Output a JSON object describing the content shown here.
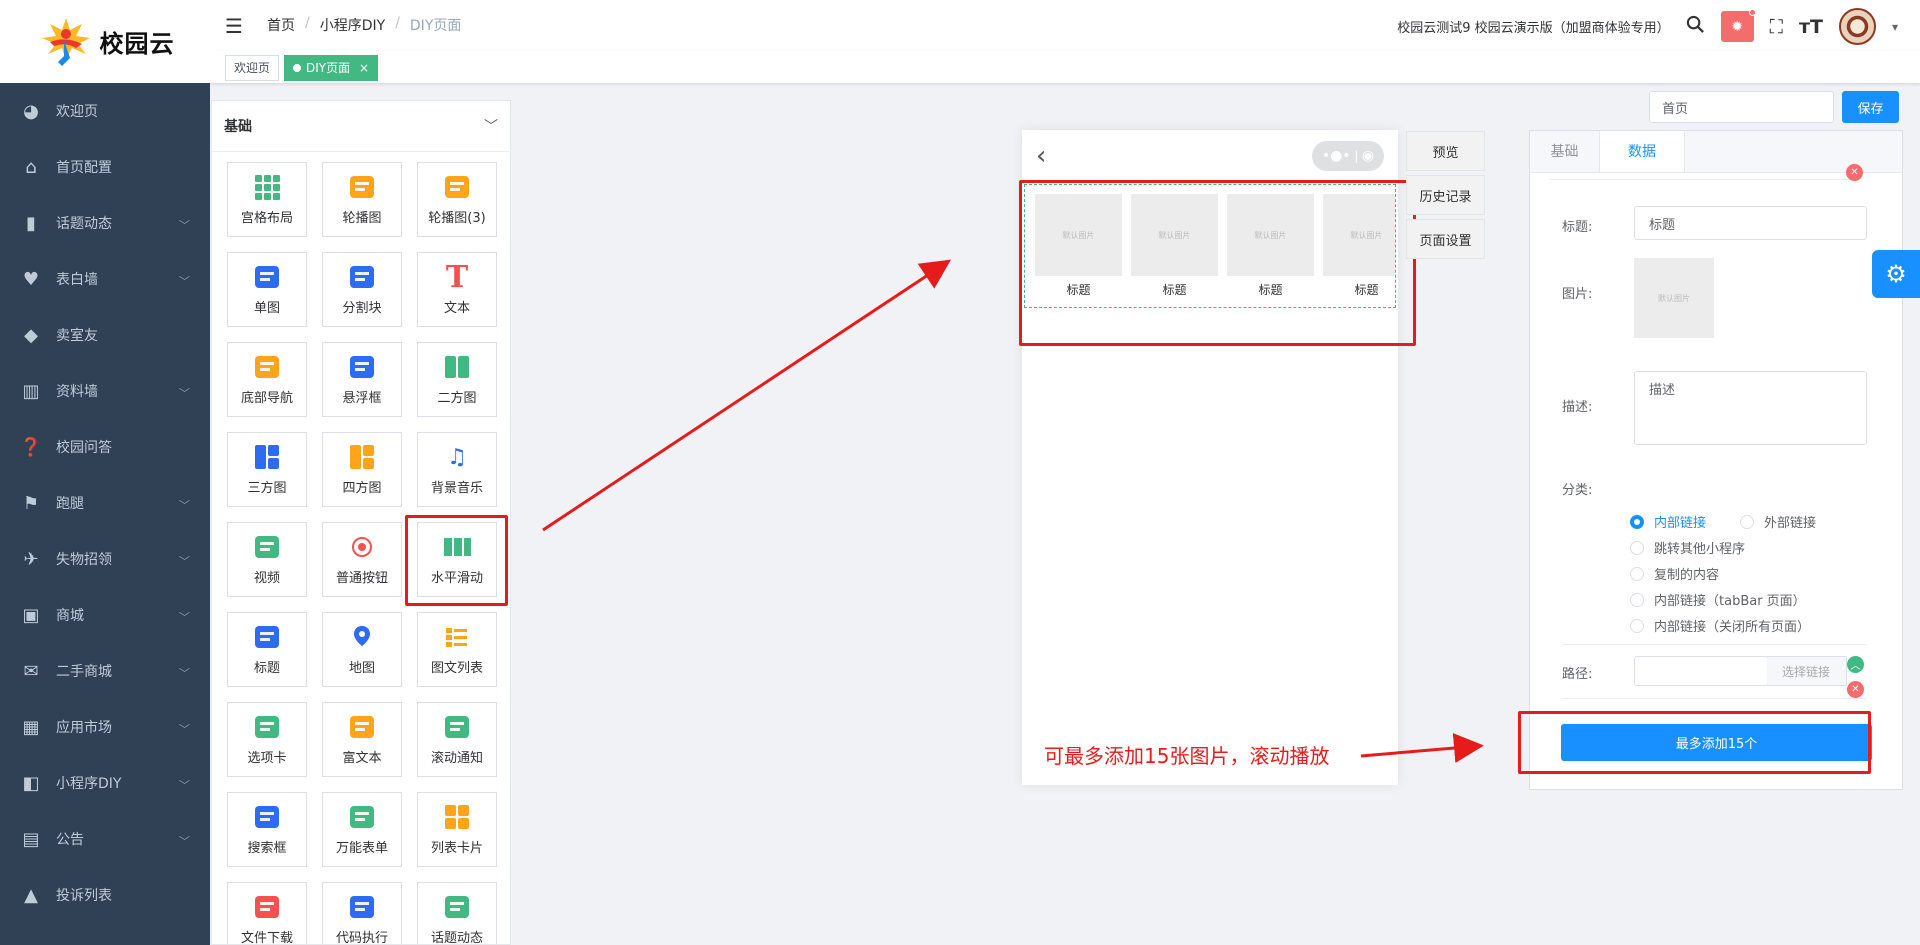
{
  "header": {
    "logo_text": "校园云",
    "breadcrumb": [
      "首页",
      "小程序DIY",
      "DIY页面"
    ],
    "breadcrumb_sep": "/",
    "site_name": "校园云测试9 校园云演示版（加盟商体验专用）",
    "icons": [
      "search-icon",
      "bug-icon",
      "fullscreen-icon",
      "font-size-icon"
    ]
  },
  "tags": [
    {
      "label": "欢迎页",
      "active": false
    },
    {
      "label": "DIY页面",
      "active": true,
      "close": "×"
    }
  ],
  "sidebar": {
    "items": [
      {
        "label": "欢迎页",
        "icon": "dashboard-icon",
        "arrow": ""
      },
      {
        "label": "首页配置",
        "icon": "home-icon",
        "arrow": ""
      },
      {
        "label": "话题动态",
        "icon": "book-icon",
        "arrow": "﹀"
      },
      {
        "label": "表白墙",
        "icon": "heart-icon",
        "arrow": "﹀"
      },
      {
        "label": "卖室友",
        "icon": "tag-icon",
        "arrow": ""
      },
      {
        "label": "资料墙",
        "icon": "library-icon",
        "arrow": "﹀"
      },
      {
        "label": "校园问答",
        "icon": "qa-icon",
        "arrow": ""
      },
      {
        "label": "跑腿",
        "icon": "errand-icon",
        "arrow": "﹀"
      },
      {
        "label": "失物招领",
        "icon": "lost-icon",
        "arrow": "﹀"
      },
      {
        "label": "商城",
        "icon": "shop-icon",
        "arrow": "﹀"
      },
      {
        "label": "二手商城",
        "icon": "gift-icon",
        "arrow": "﹀"
      },
      {
        "label": "应用市场",
        "icon": "apps-icon",
        "arrow": "﹀"
      },
      {
        "label": "小程序DIY",
        "icon": "diy-icon",
        "arrow": "﹀"
      },
      {
        "label": "公告",
        "icon": "notice-icon",
        "arrow": "﹀"
      },
      {
        "label": "投诉列表",
        "icon": "warning-icon",
        "arrow": ""
      }
    ]
  },
  "components": {
    "section_title": "基础",
    "items": [
      {
        "label": "宫格布局",
        "icon": "grid-icon",
        "color": "#42b983"
      },
      {
        "label": "轮播图",
        "icon": "carousel-icon",
        "color": "#ffa41b"
      },
      {
        "label": "轮播图(3)",
        "icon": "carousel3-icon",
        "color": "#ffa41b"
      },
      {
        "label": "单图",
        "icon": "image-icon",
        "color": "#2d6cf0"
      },
      {
        "label": "分割块",
        "icon": "divider-icon",
        "color": "#2d6cf0"
      },
      {
        "label": "文本",
        "icon": "text-icon",
        "color": "#f55151"
      },
      {
        "label": "底部导航",
        "icon": "bottom-nav-icon",
        "color": "#ffa41b"
      },
      {
        "label": "悬浮框",
        "icon": "float-icon",
        "color": "#2d6cf0"
      },
      {
        "label": "二方图",
        "icon": "two-pane-icon",
        "color": "#42b983"
      },
      {
        "label": "三方图",
        "icon": "three-pane-icon",
        "color": "#2d6cf0"
      },
      {
        "label": "四方图",
        "icon": "four-pane-icon",
        "color": "#ffa41b"
      },
      {
        "label": "背景音乐",
        "icon": "music-icon",
        "color": "#2d6cf0"
      },
      {
        "label": "视频",
        "icon": "video-icon",
        "color": "#42b983"
      },
      {
        "label": "普通按钮",
        "icon": "button-icon",
        "color": "#f55151"
      },
      {
        "label": "水平滑动",
        "icon": "slider-icon",
        "color": "#42b983"
      },
      {
        "label": "标题",
        "icon": "title-icon",
        "color": "#2d6cf0"
      },
      {
        "label": "地图",
        "icon": "map-icon",
        "color": "#2d6cf0"
      },
      {
        "label": "图文列表",
        "icon": "list-icon",
        "color": "#ffa41b"
      },
      {
        "label": "选项卡",
        "icon": "tab-icon",
        "color": "#42b983"
      },
      {
        "label": "富文本",
        "icon": "richtext-icon",
        "color": "#ffa41b"
      },
      {
        "label": "滚动通知",
        "icon": "notice-scroll-icon",
        "color": "#42b983"
      },
      {
        "label": "搜索框",
        "icon": "search-box-icon",
        "color": "#2d6cf0"
      },
      {
        "label": "万能表单",
        "icon": "form-icon",
        "color": "#42b983"
      },
      {
        "label": "列表卡片",
        "icon": "card-icon",
        "color": "#ffa41b"
      },
      {
        "label": "文件下载",
        "icon": "download-icon",
        "color": "#f55151"
      },
      {
        "label": "代码执行",
        "icon": "code-icon",
        "color": "#2d6cf0"
      },
      {
        "label": "话题动态",
        "icon": "topic-icon",
        "color": "#42b983"
      }
    ]
  },
  "preview": {
    "back": "‹",
    "placeholder_text": "默认图片",
    "slides": [
      "标题",
      "标题",
      "标题",
      "标题"
    ],
    "buttons": [
      "预览",
      "历史记录",
      "页面设置"
    ]
  },
  "settings": {
    "page_name": "首页",
    "save_label": "保存",
    "tabs": [
      "基础",
      "数据"
    ],
    "title_label": "标题:",
    "title_value": "标题",
    "image_label": "图片:",
    "image_placeholder": "默认图片",
    "desc_label": "描述:",
    "desc_value": "描述",
    "category_label": "分类:",
    "radios": [
      "内部链接",
      "外部链接",
      "跳转其他小程序",
      "复制的内容",
      "内部链接（tabBar 页面）",
      "内部链接（关闭所有页面）"
    ],
    "path_label": "路径:",
    "path_value": "",
    "select_link": "选择链接",
    "add_button": "最多添加15个"
  },
  "annotation": {
    "text": "可最多添加15张图片，滚动播放",
    "color": "#e61c1c"
  }
}
